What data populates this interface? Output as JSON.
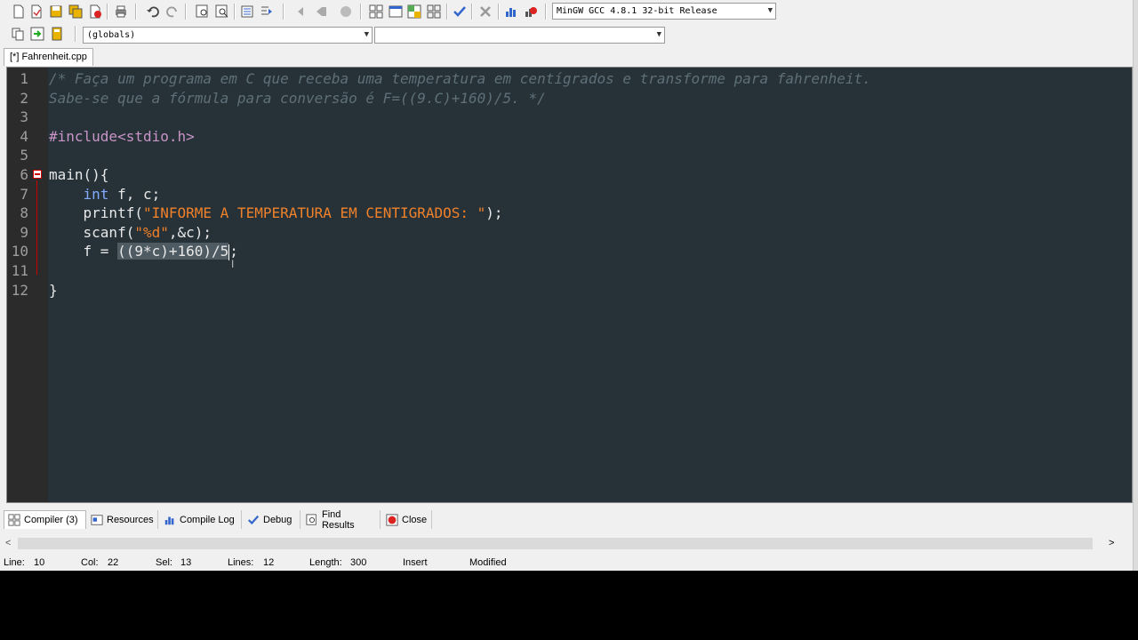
{
  "toolbar": {
    "compiler_select": "MinGW GCC 4.8.1 32-bit Release",
    "globals_select": "(globals)",
    "members_select": ""
  },
  "tab": {
    "title": "[*] Fahrenheit.cpp"
  },
  "editor": {
    "lines": [
      {
        "n": "1",
        "segments": [
          {
            "t": "/* Faça um programa em C que receba uma temperatura em centígrados e transforme para fahrenheit.",
            "c": "comment"
          }
        ]
      },
      {
        "n": "2",
        "segments": [
          {
            "t": "Sabe-se que a fórmula para conversão é F=((9.C)+160)/5. */",
            "c": "comment"
          }
        ]
      },
      {
        "n": "3",
        "segments": []
      },
      {
        "n": "4",
        "segments": [
          {
            "t": "#include<stdio.h>",
            "c": "pre"
          }
        ]
      },
      {
        "n": "5",
        "segments": []
      },
      {
        "n": "6",
        "segments": [
          {
            "t": "main(){",
            "c": "plain"
          }
        ]
      },
      {
        "n": "7",
        "segments": [
          {
            "t": "    ",
            "c": "plain"
          },
          {
            "t": "int",
            "c": "kw"
          },
          {
            "t": " f, c;",
            "c": "plain"
          }
        ]
      },
      {
        "n": "8",
        "segments": [
          {
            "t": "    printf(",
            "c": "plain"
          },
          {
            "t": "\"INFORME A TEMPERATURA EM CENTIGRADOS: \"",
            "c": "str"
          },
          {
            "t": ");",
            "c": "plain"
          }
        ]
      },
      {
        "n": "9",
        "segments": [
          {
            "t": "    scanf(",
            "c": "plain"
          },
          {
            "t": "\"%d\"",
            "c": "str"
          },
          {
            "t": ",&c);",
            "c": "plain"
          }
        ]
      },
      {
        "n": "10",
        "segments": [
          {
            "t": "    f = ",
            "c": "plain"
          },
          {
            "t": "((9*c)+160)/5",
            "c": "sel"
          },
          {
            "t": ";",
            "c": "plain"
          }
        ]
      },
      {
        "n": "11",
        "segments": []
      },
      {
        "n": "12",
        "segments": [
          {
            "t": "}",
            "c": "plain"
          }
        ]
      }
    ]
  },
  "bottom_tabs": [
    {
      "label": "Compiler (3)",
      "icon": "compiler-grid-icon"
    },
    {
      "label": "Resources",
      "icon": "resources-icon"
    },
    {
      "label": "Compile Log",
      "icon": "chart-icon"
    },
    {
      "label": "Debug",
      "icon": "check-icon"
    },
    {
      "label": "Find Results",
      "icon": "find-icon"
    },
    {
      "label": "Close",
      "icon": "close-icon"
    }
  ],
  "status": {
    "line_label": "Line:",
    "line_value": "10",
    "col_label": "Col:",
    "col_value": "22",
    "sel_label": "Sel:",
    "sel_value": "13",
    "lines_label": "Lines:",
    "lines_value": "12",
    "length_label": "Length:",
    "length_value": "300",
    "mode": "Insert",
    "state": "Modified"
  },
  "colors": {
    "editor_bg": "#263238",
    "comment": "#5f6f78",
    "string": "#f0812a",
    "keyword": "#82aaff",
    "preprocessor": "#c994c7"
  }
}
